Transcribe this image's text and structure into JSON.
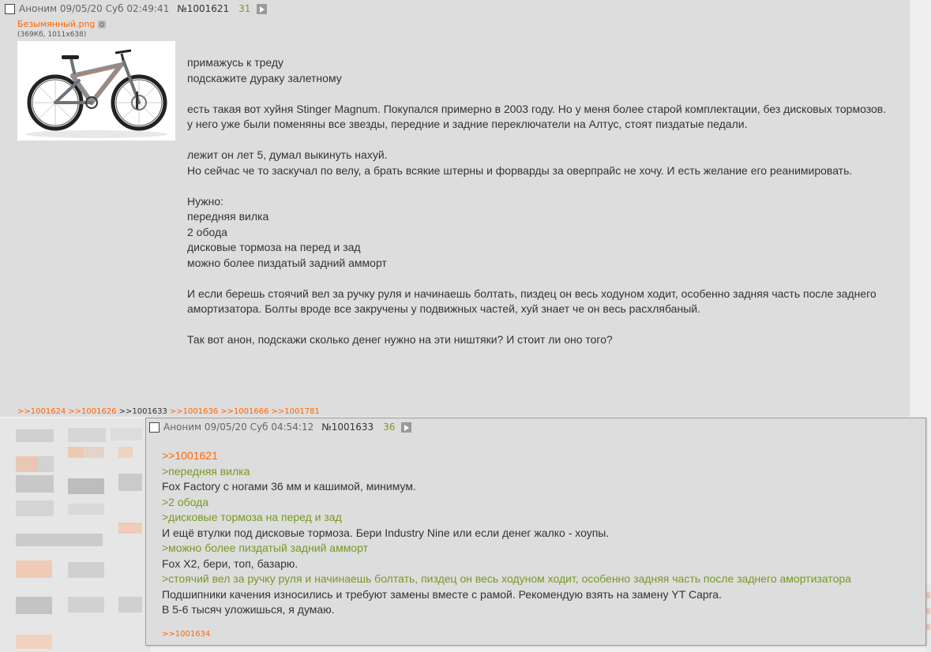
{
  "op_post": {
    "author": "Аноним",
    "datetime": "09/05/20 Суб 02:49:41",
    "number": "№1001621",
    "counter": "31",
    "file_name": "Безымянный.png",
    "file_meta": "(369Кб, 1011x638)",
    "lines": [
      "примажусь к треду",
      "подскажите дураку залетному",
      "",
      "есть такая вот хуйня Stinger Magnum. Покупался примерно в 2003 году. Но у меня более старой комплектации, без дисковых тормозов.",
      "у него уже были поменяны все звезды, передние и задние переключатели на Алтус, стоят пиздатые педали.",
      "",
      "лежит он лет 5, думал выкинуть нахуй.",
      "Но сейчас че то заскучал по велу, а брать всякие штерны и форварды за оверпрайс не хочу. И есть желание его реанимировать.",
      "",
      "Нужно:",
      "передняя вилка",
      "2 обода",
      "дисковые тормоза на перед и зад",
      "можно более пиздатый задний амморт",
      "",
      "И если берешь стоячий вел за ручку руля и начинаешь болтать, пиздец он весь ходуном ходит, особенно задняя часть после заднего амортизатора. Болты вроде все закручены у подвижных частей, хуй знает че он весь расхлябаный.",
      "",
      "Так вот анон, подскажи сколько денег нужно на эти ништяки? И стоит ли оно того?"
    ],
    "replies": [
      ">>1001624",
      ">>1001626",
      ">>1001633",
      ">>1001636",
      ">>1001666",
      ">>1001781"
    ]
  },
  "popup_post": {
    "author": "Аноним",
    "datetime": "09/05/20 Суб 04:54:12",
    "number": "№1001633",
    "counter": "36",
    "lines": [
      {
        "type": "link",
        "text": ">>1001621"
      },
      {
        "type": "green",
        "text": ">передняя вилка"
      },
      {
        "type": "text",
        "text": "Fox Factory с ногами 36 мм и кашимой, минимум."
      },
      {
        "type": "green",
        "text": ">2 обода"
      },
      {
        "type": "green",
        "text": ">дисковые тормоза на перед и зад"
      },
      {
        "type": "text",
        "text": "И ещё втулки под дисковые тормоза. Бери Industry Nine или если денег жалко - хоупы."
      },
      {
        "type": "green",
        "text": ">можно более пиздатый задний амморт"
      },
      {
        "type": "text",
        "text": "Fox X2, бери, топ, базарю."
      },
      {
        "type": "green",
        "text": ">стоячий вел за ручку руля и начинаешь болтать, пиздец он весь ходуном ходит, особенно задняя часть после заднего амортизатора"
      },
      {
        "type": "text",
        "text": "Подшипники качения износились и требуют замены вместе с рамой. Рекомендую взять на замену YT Capra."
      },
      {
        "type": "text",
        "text": "В 5-6 тысяч уложишься, я думаю."
      }
    ],
    "reply": ">>1001634"
  },
  "colors": {
    "link": "#ff6600",
    "greentext": "#789922",
    "post_bg": "#dddddd",
    "page_bg": "#eeeeee"
  }
}
